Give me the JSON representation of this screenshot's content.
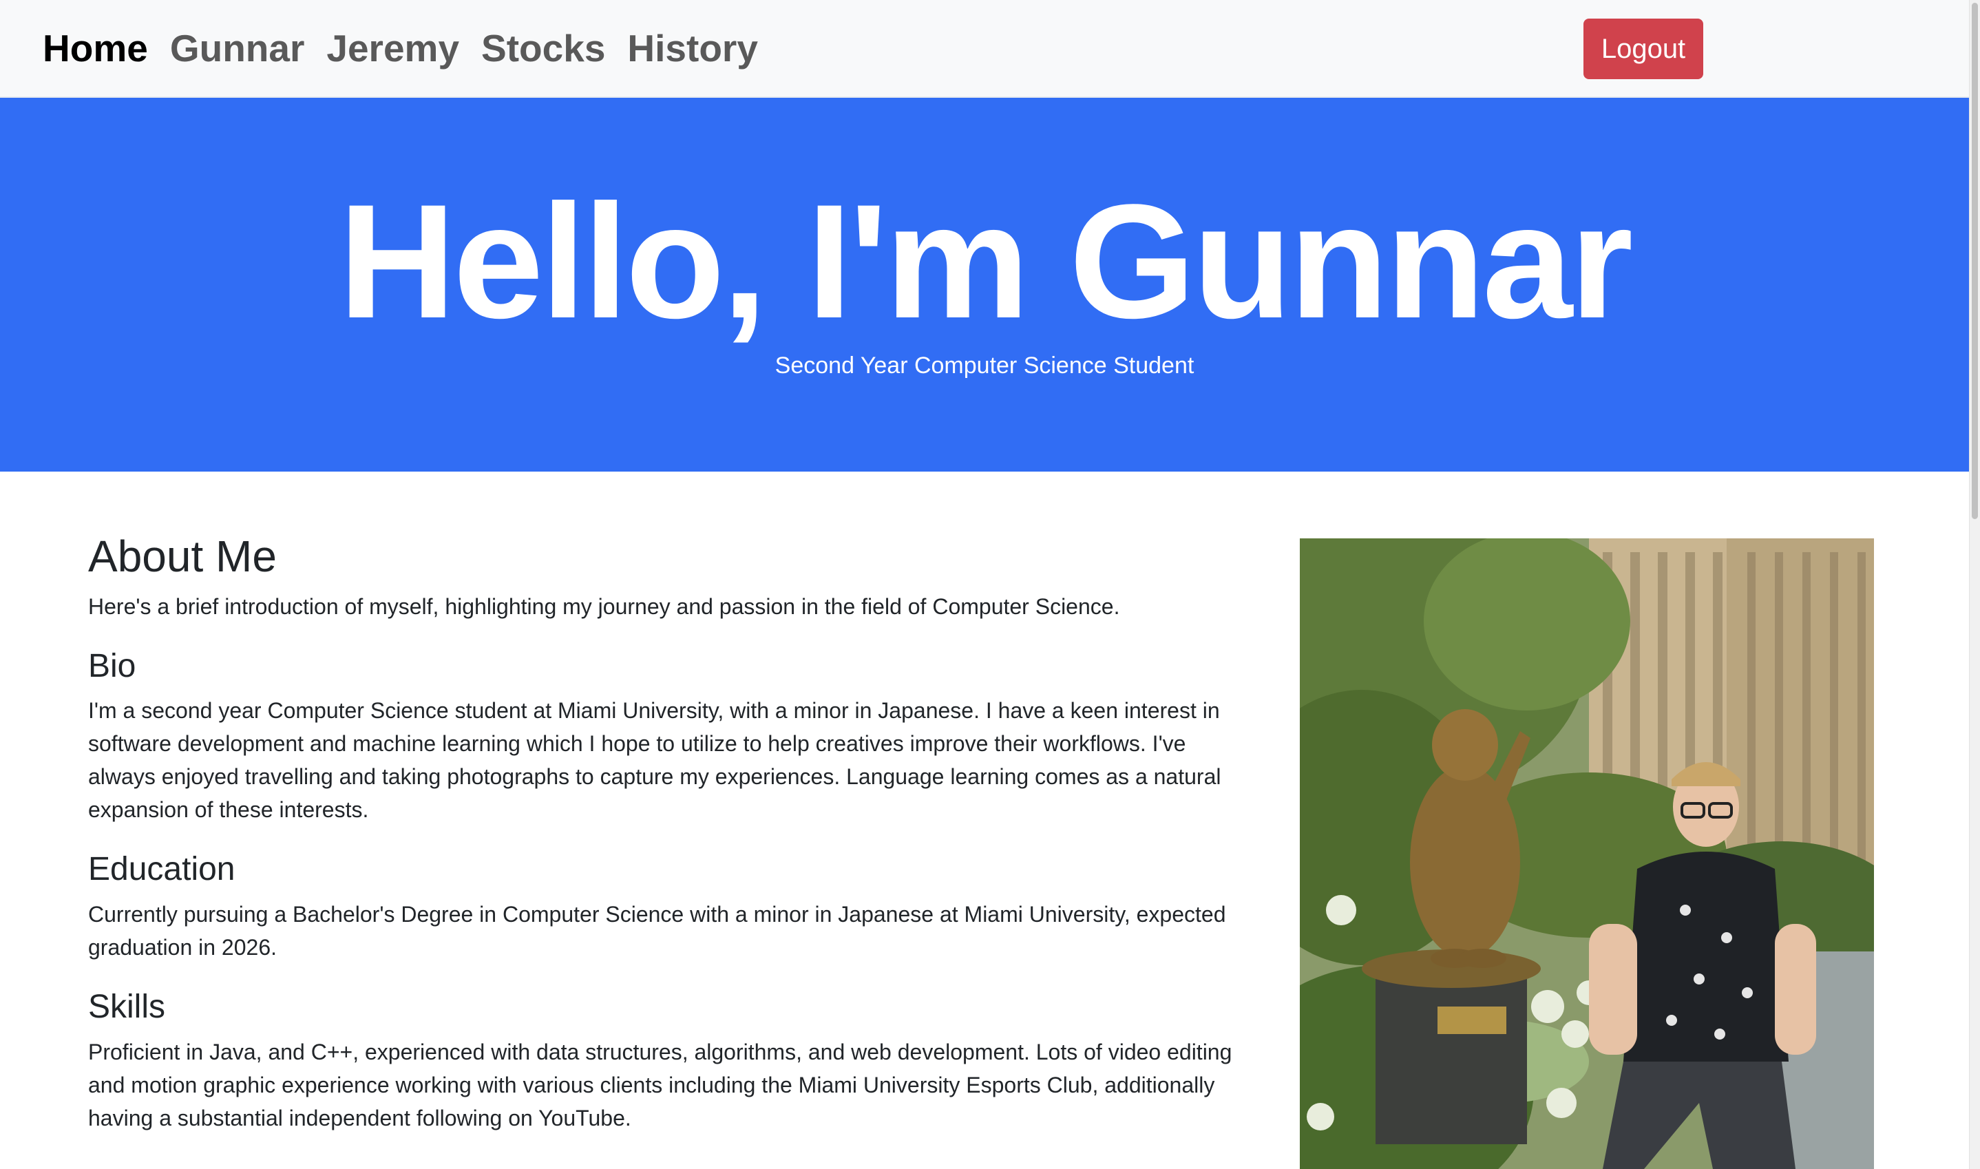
{
  "nav": {
    "links": [
      {
        "label": "Home"
      },
      {
        "label": "Gunnar"
      },
      {
        "label": "Jeremy"
      },
      {
        "label": "Stocks"
      },
      {
        "label": "History"
      }
    ],
    "logout_label": "Logout"
  },
  "hero": {
    "title": "Hello, I'm Gunnar",
    "subtitle": "Second Year Computer Science Student"
  },
  "about": {
    "heading": "About Me",
    "intro": "Here's a brief introduction of myself, highlighting my journey and passion in the field of Computer Science.",
    "bio_heading": "Bio",
    "bio_line1": "I'm a second year Computer Science student at Miami University, with a minor in Japanese. I have a keen interest in",
    "bio_line2": "software development and machine learning which I hope to utilize to help creatives improve their workflows. I've",
    "bio_line3": "always enjoyed travelling and taking photographs to capture my experiences. Language learning comes as a natural",
    "bio_line4": "expansion of these interests.",
    "education_heading": "Education",
    "education_line1": "Currently pursuing a Bachelor's Degree in Computer Science with a minor in Japanese at Miami University, expected",
    "education_line2": "graduation in 2026.",
    "skills_heading": "Skills",
    "skills_line1": "Proficient in Java, and C++, experienced with data structures, algorithms, and web development. Lots of video editing",
    "skills_line2": "and motion graphic experience working with various clients including the Miami University Esports Club, additionally",
    "skills_line3": "having a substantial independent following on YouTube."
  },
  "colors": {
    "hero_bg": "#316df4",
    "navbar_bg": "#f8f9fa",
    "logout_bg": "#d0424c"
  }
}
